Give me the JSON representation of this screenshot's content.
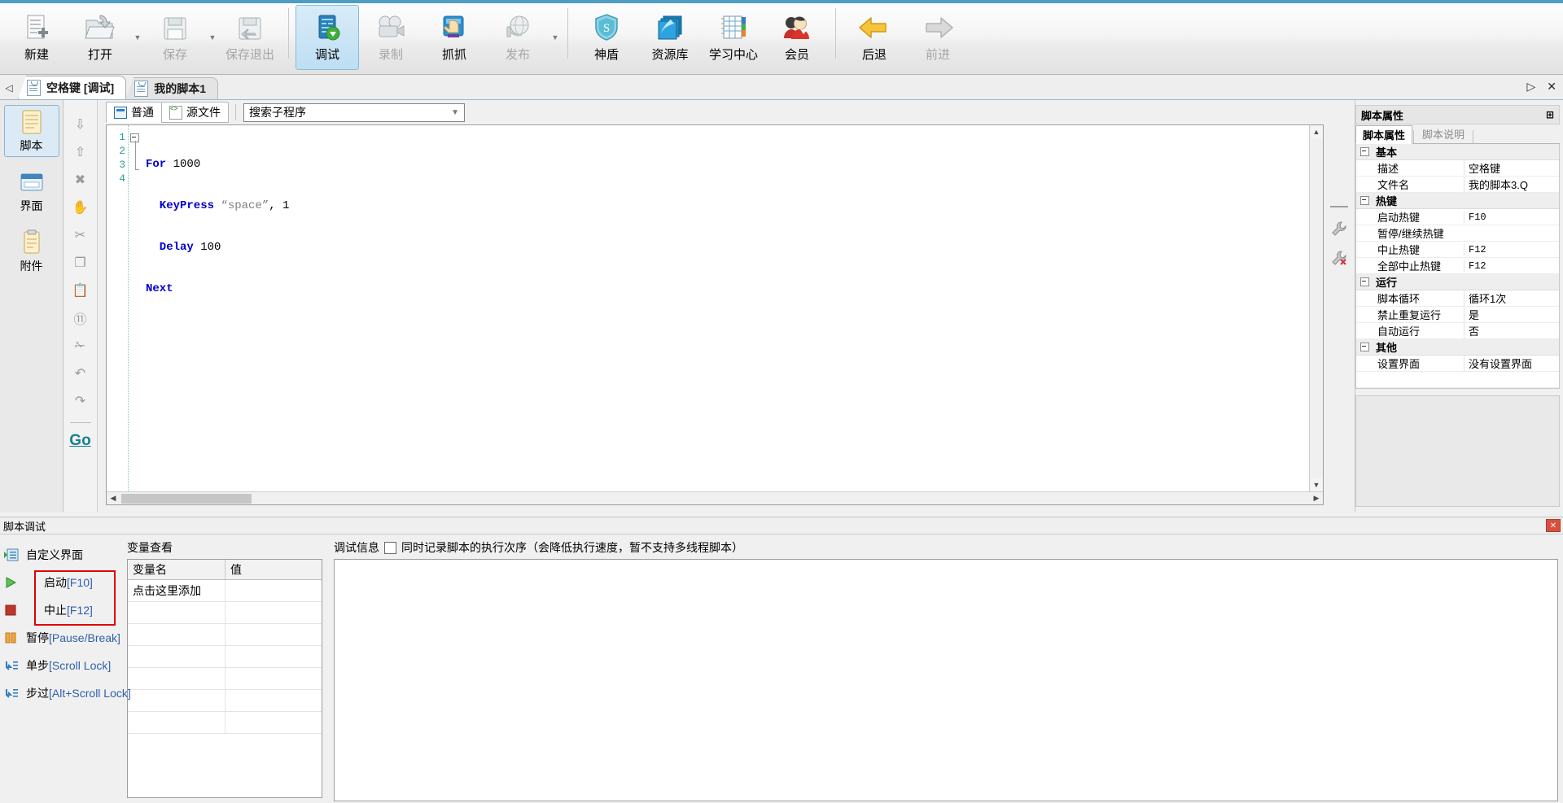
{
  "ribbon": {
    "buttons": [
      {
        "label": "新建",
        "icon": "new-file-icon",
        "state": "normal"
      },
      {
        "label": "打开",
        "icon": "open-folder-icon",
        "state": "normal",
        "caret": true
      },
      {
        "label": "保存",
        "icon": "save-disk-icon",
        "state": "disabled",
        "caret": true
      },
      {
        "label": "保存退出",
        "icon": "save-exit-icon",
        "state": "disabled"
      },
      {
        "label": "调试",
        "icon": "debug-icon",
        "state": "active"
      },
      {
        "label": "录制",
        "icon": "record-camera-icon",
        "state": "disabled"
      },
      {
        "label": "抓抓",
        "icon": "grab-hand-icon",
        "state": "normal"
      },
      {
        "label": "发布",
        "icon": "publish-globe-icon",
        "state": "disabled",
        "caret": true
      },
      {
        "label": "神盾",
        "icon": "shield-icon",
        "state": "normal"
      },
      {
        "label": "资源库",
        "icon": "resource-library-icon",
        "state": "normal"
      },
      {
        "label": "学习中心",
        "icon": "learning-center-icon",
        "state": "normal"
      },
      {
        "label": "会员",
        "icon": "member-user-icon",
        "state": "normal"
      },
      {
        "label": "后退",
        "icon": "back-arrow-icon",
        "state": "normal"
      },
      {
        "label": "前进",
        "icon": "forward-arrow-icon",
        "state": "disabled"
      }
    ]
  },
  "tabstrip": {
    "scroll_left": "◁",
    "tabs": [
      {
        "label": "空格键 [调试]",
        "selected": true
      },
      {
        "label": "我的脚本1",
        "selected": false
      }
    ],
    "nav_right": "▷",
    "close": "✕"
  },
  "leftnav": {
    "items": [
      {
        "label": "脚本",
        "icon": "script-pad-icon",
        "selected": true
      },
      {
        "label": "界面",
        "icon": "ui-window-icon",
        "selected": false
      },
      {
        "label": "附件",
        "icon": "attachment-icon",
        "selected": false
      }
    ]
  },
  "toolcolumn": {
    "items": [
      {
        "name": "move-down-icon",
        "glyph": "⇩"
      },
      {
        "name": "move-up-icon",
        "glyph": "⇧"
      },
      {
        "name": "delete-icon",
        "glyph": "✖"
      },
      {
        "name": "hand-icon",
        "glyph": "✋"
      },
      {
        "name": "cut-icon",
        "glyph": "✂"
      },
      {
        "name": "copy-icon",
        "glyph": "❐"
      },
      {
        "name": "paste-icon",
        "glyph": "📋"
      },
      {
        "name": "link-icon",
        "glyph": "⑪"
      },
      {
        "name": "scissors-icon",
        "glyph": "✁"
      },
      {
        "name": "undo-icon",
        "glyph": "↶"
      },
      {
        "name": "redo-icon",
        "glyph": "↷"
      }
    ],
    "go_label": "Go"
  },
  "editor": {
    "view_tabs": [
      {
        "label": "普通",
        "icon": "normal-view-icon",
        "selected": true
      },
      {
        "label": "源文件",
        "icon": "source-file-icon",
        "selected": false
      }
    ],
    "search": {
      "value": "搜索子程序",
      "placeholder": "搜索子程序",
      "caret": "▼"
    },
    "lines": [
      {
        "no": "1",
        "tokens": [
          {
            "t": "For",
            "c": "kw"
          },
          {
            "t": " 1000",
            "c": "num"
          }
        ]
      },
      {
        "no": "2",
        "tokens": [
          {
            "t": "  KeyPress",
            "c": "kw"
          },
          {
            "t": " \"space\"",
            "c": "str"
          },
          {
            "t": ", 1",
            "c": "num"
          }
        ]
      },
      {
        "no": "3",
        "tokens": [
          {
            "t": "  Delay",
            "c": "kw"
          },
          {
            "t": " 100",
            "c": "num"
          }
        ]
      },
      {
        "no": "4",
        "tokens": [
          {
            "t": "Next",
            "c": "kw"
          }
        ]
      }
    ],
    "code_text": "For 1000\n  KeyPress \"space\", 1\n  Delay 100\nNext"
  },
  "properties": {
    "title": "脚本属性",
    "pin": "⊞",
    "tabs": [
      {
        "label": "脚本属性",
        "selected": true
      },
      {
        "label": "脚本说明",
        "selected": false
      }
    ],
    "rows": [
      {
        "type": "category",
        "name": "基本"
      },
      {
        "type": "item",
        "name": "描述",
        "value": "空格键",
        "cn": true
      },
      {
        "type": "item",
        "name": "文件名",
        "value": "我的脚本3.Q",
        "cn": true
      },
      {
        "type": "category",
        "name": "热键"
      },
      {
        "type": "item",
        "name": "启动热键",
        "value": "F10"
      },
      {
        "type": "item",
        "name": "暂停/继续热键",
        "value": ""
      },
      {
        "type": "item",
        "name": "中止热键",
        "value": "F12"
      },
      {
        "type": "item",
        "name": "全部中止热键",
        "value": "F12"
      },
      {
        "type": "category",
        "name": "运行"
      },
      {
        "type": "item",
        "name": "脚本循环",
        "value": "循环1次",
        "cn": true
      },
      {
        "type": "item",
        "name": "禁止重复运行",
        "value": "是",
        "cn": true
      },
      {
        "type": "item",
        "name": "自动运行",
        "value": "否",
        "cn": true
      },
      {
        "type": "category",
        "name": "其他"
      },
      {
        "type": "item",
        "name": "设置界面",
        "value": "没有设置界面",
        "cn": true
      },
      {
        "type": "item",
        "name": "",
        "value": ""
      }
    ]
  },
  "debug": {
    "title": "脚本调试",
    "close": "✕",
    "actions": [
      {
        "label": "自定义界面",
        "key": "",
        "icon": "custom-ui-icon",
        "indent": true
      },
      {
        "label": "启动",
        "key": "[F10]",
        "icon": "play-icon",
        "indent": true
      },
      {
        "label": "中止",
        "key": "[F12]",
        "icon": "stop-icon",
        "indent": true
      },
      {
        "label": "暂停",
        "key": "[Pause/Break]",
        "icon": "pause-icon",
        "indent": false
      },
      {
        "label": "单步",
        "key": "[Scroll Lock]",
        "icon": "step-into-icon",
        "indent": false
      },
      {
        "label": "步过",
        "key": "[Alt+Scroll Lock]",
        "icon": "step-over-icon",
        "indent": false
      }
    ],
    "variables": {
      "title": "变量查看",
      "columns": [
        "变量名",
        "值"
      ],
      "rows": [
        [
          "点击这里添加",
          ""
        ],
        [
          "",
          ""
        ],
        [
          "",
          ""
        ],
        [
          "",
          ""
        ],
        [
          "",
          ""
        ],
        [
          "",
          ""
        ],
        [
          "",
          ""
        ]
      ]
    },
    "info": {
      "title": "调试信息",
      "checkbox_label": "同时记录脚本的执行次序（会降低执行速度，暂不支持多线程脚本）",
      "checked": false,
      "content": ""
    }
  }
}
